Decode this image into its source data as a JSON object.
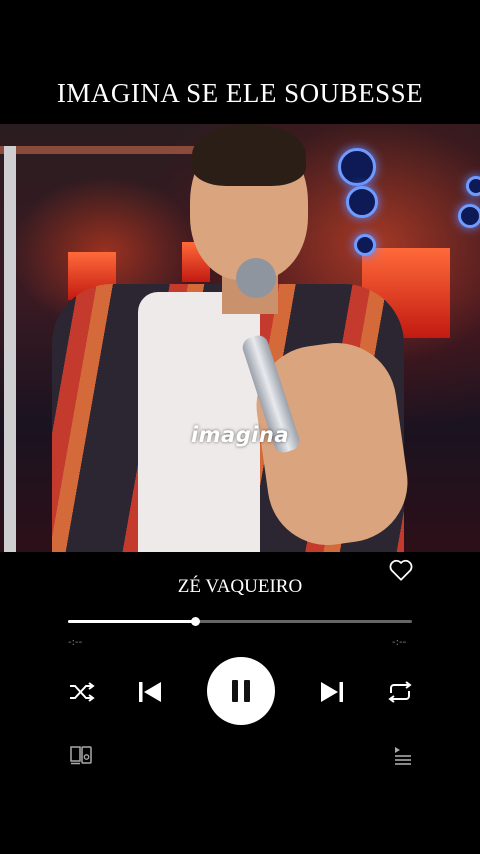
{
  "header": {
    "title": "IMAGINA SE ELE SOUBESSE"
  },
  "video": {
    "lyric": "imagina"
  },
  "player": {
    "artist": "ZÉ VAQUEIRO",
    "progress": 0.37,
    "time_elapsed": "-:--",
    "time_remaining": "-:--",
    "state": "playing"
  },
  "icons": {
    "favorite": "heart-outline-icon",
    "shuffle": "shuffle-icon",
    "previous": "skip-previous-icon",
    "pause": "pause-icon",
    "next": "skip-next-icon",
    "repeat": "repeat-icon",
    "devices": "connect-device-icon",
    "queue": "queue-icon"
  },
  "colors": {
    "background": "#000000",
    "foreground": "#ffffff",
    "track": "#666666"
  }
}
